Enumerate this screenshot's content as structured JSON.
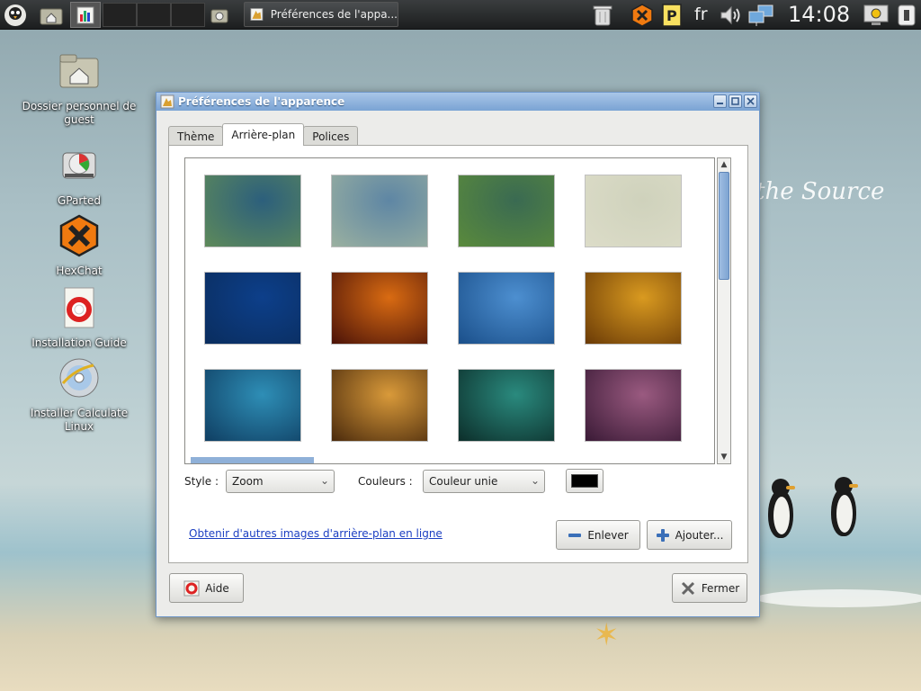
{
  "panel": {
    "active_task": "Préférences de l'appa...",
    "language": "fr",
    "clock": "14:08"
  },
  "desktop": {
    "icons": [
      {
        "label": "Dossier personnel de guest",
        "icon": "home-folder-icon"
      },
      {
        "label": "GParted",
        "icon": "gparted-icon"
      },
      {
        "label": "HexChat",
        "icon": "hexchat-icon"
      },
      {
        "label": "Installation Guide",
        "icon": "help-guide-icon"
      },
      {
        "label": "Installer Calculate Linux",
        "icon": "installer-disc-icon"
      }
    ],
    "wallpaper_text": "the Source"
  },
  "window": {
    "title": "Préférences de l'apparence",
    "tabs": [
      {
        "label": "Thème",
        "active": false
      },
      {
        "label": "Arrière-plan",
        "active": true
      },
      {
        "label": "Polices",
        "active": false
      }
    ],
    "style_label": "Style :",
    "style_value": "Zoom",
    "colors_label": "Couleurs :",
    "colors_value": "Couleur unie",
    "color_swatch": "#000000",
    "online_link": "Obtenir d'autres images d'arrière-plan en ligne",
    "remove_button": "Enlever",
    "add_button": "Ajouter...",
    "help_button": "Aide",
    "close_button": "Fermer",
    "wallpapers": [
      {
        "name": "wallpaper-teal-green",
        "colors": [
          "#2c5f7c",
          "#5e8a5a"
        ]
      },
      {
        "name": "wallpaper-pale-blue-waves",
        "colors": [
          "#5e86a4",
          "#9ab0a0"
        ]
      },
      {
        "name": "wallpaper-green-stripes",
        "colors": [
          "#3a6a52",
          "#5a8a3c"
        ]
      },
      {
        "name": "wallpaper-sand",
        "colors": [
          "#cfd2bc",
          "#dcdcc8"
        ]
      },
      {
        "name": "wallpaper-blue-night",
        "colors": [
          "#0d3f8a",
          "#0a2d5e"
        ]
      },
      {
        "name": "wallpaper-orange-sunset",
        "colors": [
          "#d96b12",
          "#4a1208"
        ]
      },
      {
        "name": "wallpaper-blue-rays",
        "colors": [
          "#4d8fd0",
          "#1a4f8a"
        ]
      },
      {
        "name": "wallpaper-golden",
        "colors": [
          "#d99a20",
          "#6a3a06"
        ]
      },
      {
        "name": "wallpaper-aurora-cyan",
        "colors": [
          "#2e8eb6",
          "#0f3e62"
        ]
      },
      {
        "name": "wallpaper-aurora-amber",
        "colors": [
          "#d99a3a",
          "#4a2a0c"
        ]
      },
      {
        "name": "wallpaper-aurora-teal",
        "colors": [
          "#2a8a7e",
          "#0c2e2a"
        ]
      },
      {
        "name": "wallpaper-aurora-mauve",
        "colors": [
          "#9a5a80",
          "#3a1a36"
        ]
      }
    ]
  }
}
